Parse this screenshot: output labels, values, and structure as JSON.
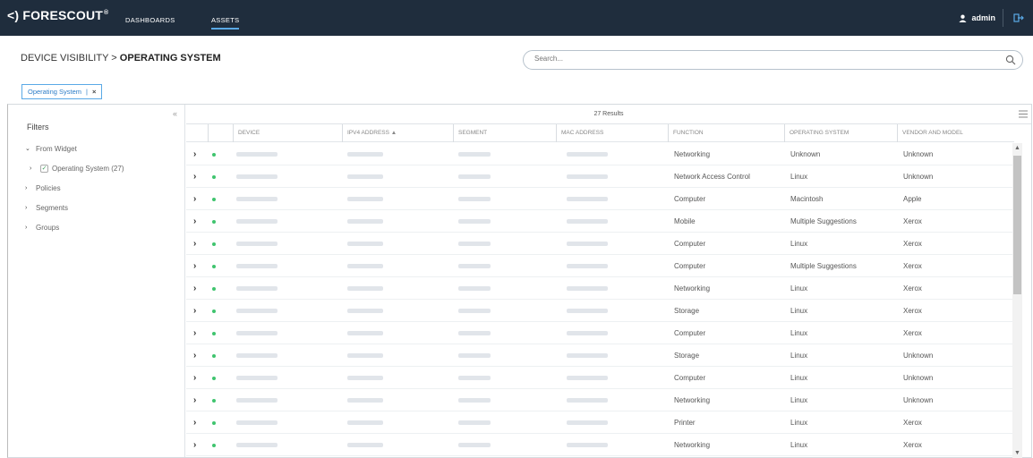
{
  "topbar": {
    "logo": "<) FORESCOUT",
    "logo_mark": "®",
    "nav": [
      "DASHBOARDS",
      "ASSETS"
    ],
    "active_nav": "ASSETS",
    "user": "admin"
  },
  "breadcrumb": {
    "parent": "DEVICE VISIBILITY",
    "separator": ">",
    "current": "OPERATING SYSTEM"
  },
  "search": {
    "placeholder": "Search..."
  },
  "filter_chip": {
    "label": "Operating System",
    "separator": "|",
    "remove": "×"
  },
  "sidebar": {
    "title": "Filters",
    "collapse": "«",
    "items": [
      {
        "label": "From Widget",
        "expanded": true
      },
      {
        "label": "Operating System (27)",
        "sub": true,
        "checked": true
      },
      {
        "label": "Policies"
      },
      {
        "label": "Segments"
      },
      {
        "label": "Groups"
      }
    ]
  },
  "table": {
    "results": "27 Results",
    "columns": [
      "DEVICE",
      "IPV4 ADDRESS ▲",
      "SEGMENT",
      "MAC ADDRESS",
      "FUNCTION",
      "OPERATING SYSTEM",
      "VENDOR AND MODEL"
    ],
    "rows": [
      {
        "function": "Networking",
        "os": "Unknown",
        "vendor": "Unknown"
      },
      {
        "function": "Network Access Control",
        "os": "Linux",
        "vendor": "Unknown"
      },
      {
        "function": "Computer",
        "os": "Macintosh",
        "vendor": "Apple"
      },
      {
        "function": "Mobile",
        "os": "Multiple Suggestions",
        "vendor": "Xerox"
      },
      {
        "function": "Computer",
        "os": "Linux",
        "vendor": "Xerox"
      },
      {
        "function": "Computer",
        "os": "Multiple Suggestions",
        "vendor": "Xerox"
      },
      {
        "function": "Networking",
        "os": "Linux",
        "vendor": "Xerox"
      },
      {
        "function": "Storage",
        "os": "Linux",
        "vendor": "Xerox"
      },
      {
        "function": "Computer",
        "os": "Linux",
        "vendor": "Xerox"
      },
      {
        "function": "Storage",
        "os": "Linux",
        "vendor": "Unknown"
      },
      {
        "function": "Computer",
        "os": "Linux",
        "vendor": "Unknown"
      },
      {
        "function": "Networking",
        "os": "Linux",
        "vendor": "Unknown"
      },
      {
        "function": "Printer",
        "os": "Linux",
        "vendor": "Xerox"
      },
      {
        "function": "Networking",
        "os": "Linux",
        "vendor": "Xerox"
      }
    ]
  },
  "colors": {
    "topbar": "#1f2d3d",
    "accent": "#5aa9e6",
    "online_dot": "#3fc46e"
  }
}
